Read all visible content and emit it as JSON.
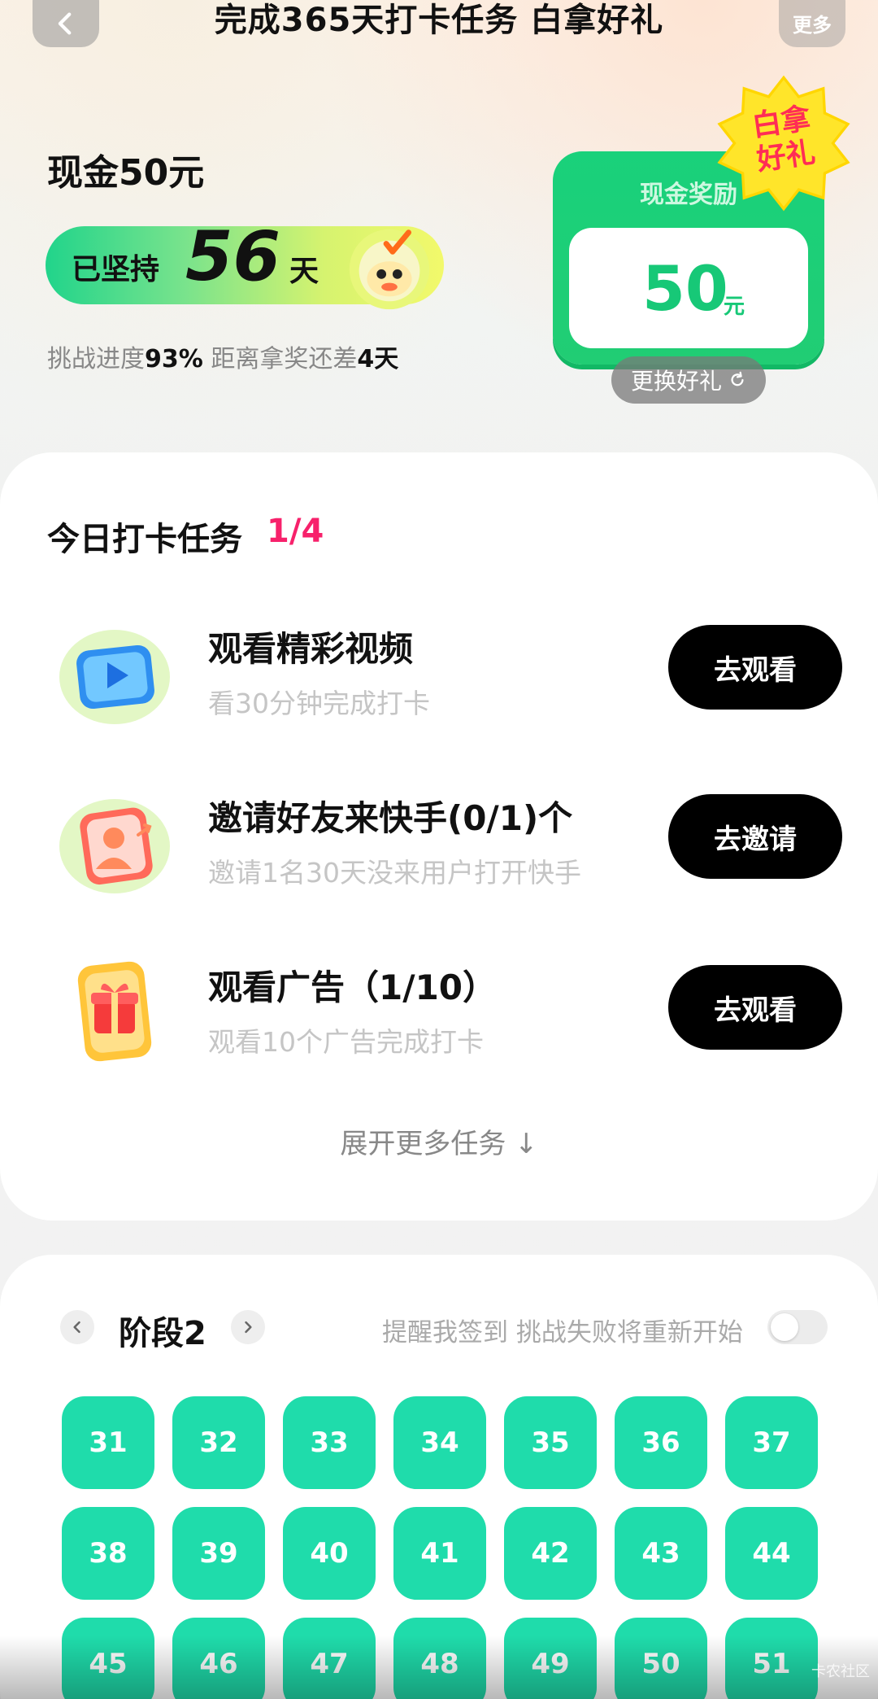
{
  "header": {
    "title": "完成365天打卡任务 白拿好礼",
    "more_label": "更多"
  },
  "summary": {
    "reward_heading": "现金50元",
    "persist_prefix": "已坚持",
    "persist_days": "56",
    "persist_unit": "天",
    "progress_label": "挑战进度",
    "progress_value": "93%",
    "remaining_label": " 距离拿奖还差",
    "remaining_value": "4天"
  },
  "reward_card": {
    "title": "现金奖励",
    "amount": "50",
    "unit": "元",
    "badge_line1": "白拿",
    "badge_line2": "好礼",
    "change_label": "更换好礼",
    "change_icon": "refresh-icon"
  },
  "tasks": {
    "title": "今日打卡任务",
    "count": "1/4",
    "items": [
      {
        "icon": "video-play-icon",
        "title": "观看精彩视频",
        "subtitle": "看30分钟完成打卡",
        "button": "去观看"
      },
      {
        "icon": "invite-user-icon",
        "title": "邀请好友来快手(0/1)个",
        "subtitle": "邀请1名30天没来用户打开快手",
        "button": "去邀请"
      },
      {
        "icon": "gift-ad-icon",
        "title": "观看广告（1/10）",
        "subtitle": "观看10个广告完成打卡",
        "button": "去观看"
      }
    ],
    "expand_label": "展开更多任务 ↓"
  },
  "stage": {
    "label": "阶段2",
    "remind_text": "提醒我签到 挑战失败将重新开始",
    "remind_enabled": false,
    "days": [
      "31",
      "32",
      "33",
      "34",
      "35",
      "36",
      "37",
      "38",
      "39",
      "40",
      "41",
      "42",
      "43",
      "44",
      "45",
      "46",
      "47",
      "48",
      "49",
      "50",
      "51"
    ]
  },
  "watermark": "卡农社区",
  "colors": {
    "accent_green": "#1fdcab",
    "reward_green": "#19d17b",
    "count_pink": "#f7216b",
    "button_black": "#000000"
  }
}
